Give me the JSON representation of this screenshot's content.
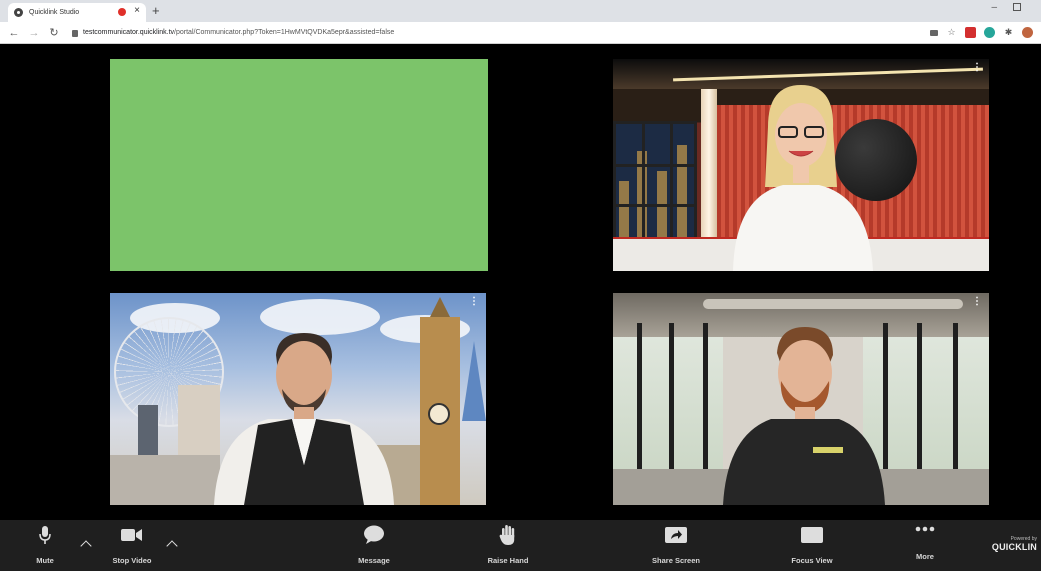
{
  "browser": {
    "tab_title": "Quicklink Studio",
    "tab_close": "×",
    "new_tab": "+",
    "minimize": "–",
    "url_host": "testcommunicator.quicklink.tv",
    "url_path": "/portal/Communicator.php?Token=1HwMVtQVDKa5epr&assisted=false"
  },
  "toolbar": {
    "mute_label": "Mute",
    "stop_video_label": "Stop Video",
    "message_label": "Message",
    "raise_hand_label": "Raise Hand",
    "share_screen_label": "Share Screen",
    "focus_view_label": "Focus View",
    "more_label": "More",
    "powered_by": "Powered by",
    "brand": "QUICKLIN"
  },
  "tiles": {
    "kebab": "⋮"
  },
  "colors": {
    "stage_bg": "#000000",
    "toolbar_bg": "#1f1f1f",
    "green_screen": "#7cc46a",
    "toolbar_text": "#d6d6d6"
  }
}
